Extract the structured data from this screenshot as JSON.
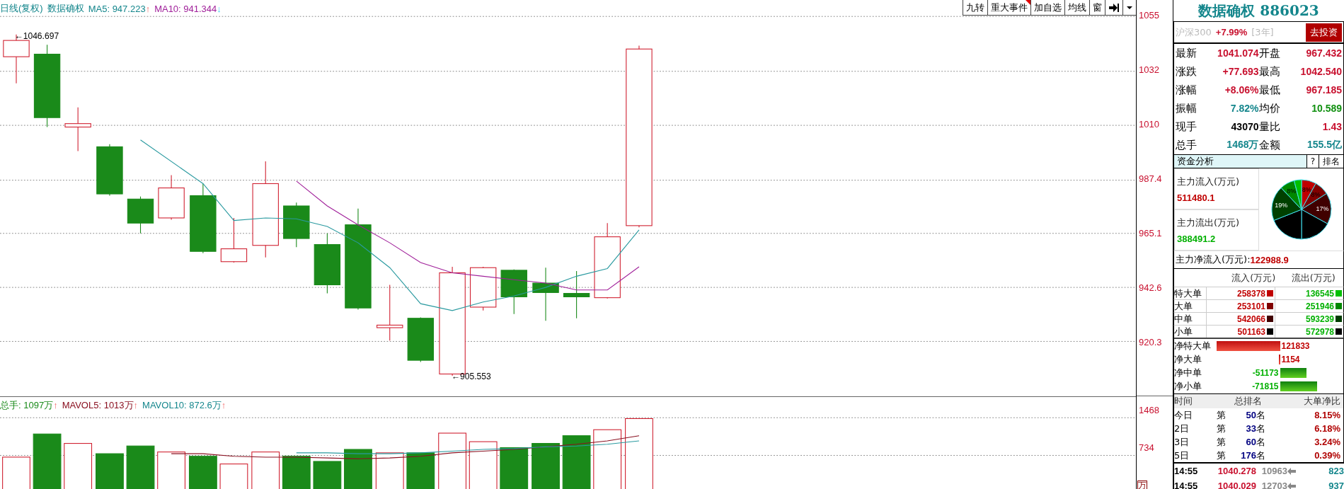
{
  "chart_header": {
    "title": "日线(复权)",
    "name": "数据确权",
    "ma5": "MA5: 947.223",
    "ma5_arrow": "↑",
    "ma10": "MA10: 941.344",
    "ma10_arrow": "↓"
  },
  "toolbar": [
    {
      "label": "九转",
      "flagged": false
    },
    {
      "label": "重大事件",
      "flagged": true
    },
    {
      "label": "加自选",
      "flagged": false
    },
    {
      "label": "均线",
      "flagged": false
    },
    {
      "label": "窗",
      "flagged": false
    }
  ],
  "price_axis": [
    "1055",
    "1032",
    "1010",
    "987.4",
    "965.1",
    "942.6",
    "920.3"
  ],
  "high_label": "←1046.697",
  "low_label": "←905.553",
  "volume_header": {
    "total": "总手: 1097万",
    "total_arrow": "↑",
    "mavol5": "MAVOL5: 1013万",
    "mavol5_arrow": "↑",
    "mavol10": "MAVOL10: 872.6万",
    "mavol10_arrow": "↑"
  },
  "volume_axis": [
    "1468",
    "734"
  ],
  "volume_unit": "万",
  "quote": {
    "title": "数据确权 886023",
    "benchmark": "沪深300",
    "benchmark_change": "+7.99%",
    "period": "[3年]",
    "invest_button": "去投资",
    "fields": [
      {
        "label": "最新",
        "value": "1041.074",
        "color": "#c8102e"
      },
      {
        "label": "开盘",
        "value": "967.432",
        "color": "#c8102e"
      },
      {
        "label": "涨跌",
        "value": "+77.693",
        "color": "#c8102e"
      },
      {
        "label": "最高",
        "value": "1042.540",
        "color": "#c8102e"
      },
      {
        "label": "涨幅",
        "value": "+8.06%",
        "color": "#c8102e"
      },
      {
        "label": "最低",
        "value": "967.185",
        "color": "#c8102e"
      },
      {
        "label": "振幅",
        "value": "7.82%",
        "color": "#14868c"
      },
      {
        "label": "均价",
        "value": "10.589",
        "color": "#109010"
      },
      {
        "label": "现手",
        "value": "43070",
        "color": "#000000"
      },
      {
        "label": "量比",
        "value": "1.43",
        "color": "#c8102e"
      },
      {
        "label": "总手",
        "value": "1468万",
        "color": "#14868c"
      },
      {
        "label": "金额",
        "value": "155.5亿",
        "color": "#14868c"
      }
    ]
  },
  "fund_flow": {
    "title": "资金分析",
    "help": "?",
    "rank_button": "排名",
    "inflow_label": "主力流入(万元)",
    "inflow": "511480.1",
    "outflow_label": "主力流出(万元)",
    "outflow": "388491.2",
    "chart_data": {
      "type": "pie",
      "values": [
        8,
        8,
        17,
        17,
        19,
        19,
        8,
        4
      ],
      "value_labels": [
        "8%",
        "8%",
        "17%",
        null,
        null,
        "19%",
        "8%",
        null
      ]
    },
    "net_label": "主力净流入(万元):",
    "net": "122988.9"
  },
  "orders": {
    "columns": [
      "流入(万元)",
      "流出(万元)"
    ],
    "rows": [
      {
        "label": "特大单",
        "inflow": {
          "value": "258378",
          "color": "#c00000"
        },
        "outflow": {
          "value": "136545",
          "color": "#00c000"
        }
      },
      {
        "label": "大单",
        "inflow": {
          "value": "253101",
          "color": "#800000"
        },
        "outflow": {
          "value": "251946",
          "color": "#008800"
        }
      },
      {
        "label": "中单",
        "inflow": {
          "value": "542066",
          "color": "#400000"
        },
        "outflow": {
          "value": "593239",
          "color": "#003c00"
        }
      },
      {
        "label": "小单",
        "inflow": {
          "value": "501163",
          "color": "#000000"
        },
        "outflow": {
          "value": "572978",
          "color": "#000000"
        }
      }
    ]
  },
  "net_orders": [
    {
      "label": "净特大单",
      "value": "121833",
      "kind": "inflow"
    },
    {
      "label": "净大单",
      "value": "1154",
      "kind": "inflow"
    },
    {
      "label": "净中单",
      "value": "-51173",
      "kind": "outflow"
    },
    {
      "label": "净小单",
      "value": "-71815",
      "kind": "outflow"
    }
  ],
  "ranking": {
    "columns": [
      "时间",
      "总排名",
      "大单净比"
    ],
    "rows": [
      {
        "period": "今日",
        "prefix": "第",
        "rank": "50",
        "suffix": "名",
        "ratio": "8.15%"
      },
      {
        "period": "2日",
        "prefix": "第",
        "rank": "33",
        "suffix": "名",
        "ratio": "6.18%"
      },
      {
        "period": "3日",
        "prefix": "第",
        "rank": "60",
        "suffix": "名",
        "ratio": "3.24%"
      },
      {
        "period": "5日",
        "prefix": "第",
        "rank": "176",
        "suffix": "名",
        "ratio": "0.39%"
      }
    ]
  },
  "ticks": [
    {
      "time": "14:55",
      "price": "1040.278",
      "volume": "10963",
      "count": "823"
    },
    {
      "time": "14:55",
      "price": "1040.029",
      "volume": "12703",
      "count": "937"
    }
  ]
}
